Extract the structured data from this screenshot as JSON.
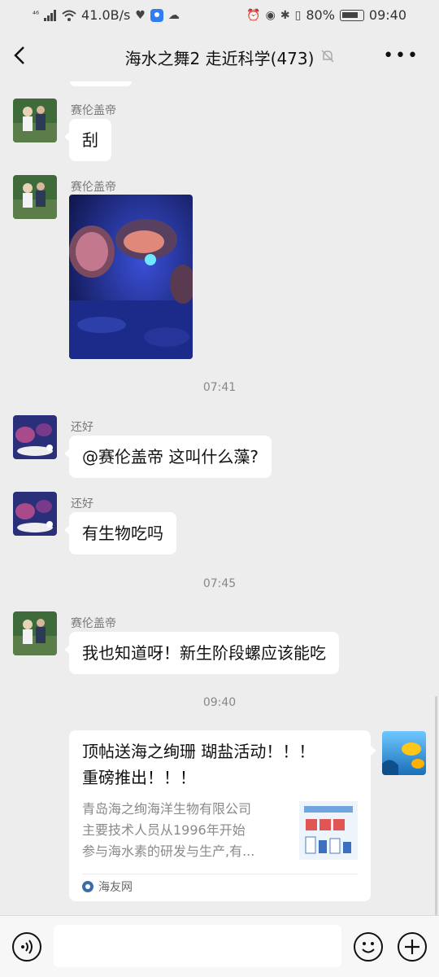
{
  "status_bar": {
    "network": "⁴⁶",
    "speed": "41.0B/s",
    "battery_percent": "80%",
    "battery_level": 0.8,
    "time": "09:40"
  },
  "header": {
    "title": "海水之舞2 走近科学(473)"
  },
  "messages": [
    {
      "sender": "赛伦盖帝",
      "text": "刮"
    },
    {
      "sender": "赛伦盖帝",
      "type": "image"
    },
    {
      "time": "07:41"
    },
    {
      "sender": "还好",
      "text": "@赛伦盖帝  这叫什么藻?"
    },
    {
      "sender": "还好",
      "text": "有生物吃吗"
    },
    {
      "time": "07:45"
    },
    {
      "sender": "赛伦盖帝",
      "text": "我也知道呀！新生阶段螺应该能吃"
    },
    {
      "time": "09:40"
    }
  ],
  "link_card": {
    "title_line1": "顶帖送海之绚珊 瑚盐活动！！！",
    "title_line2": "重磅推出！！！",
    "desc_line1": "青岛海之绚海洋生物有限公司",
    "desc_line2": "主要技术人员从1996年开始",
    "desc_line3": "参与海水素的研发与生产,有...",
    "source": "海友网"
  },
  "input": {
    "placeholder": ""
  },
  "colors": {
    "background": "#ededed",
    "bubble": "#ffffff",
    "nickname": "#7a7a7a"
  }
}
